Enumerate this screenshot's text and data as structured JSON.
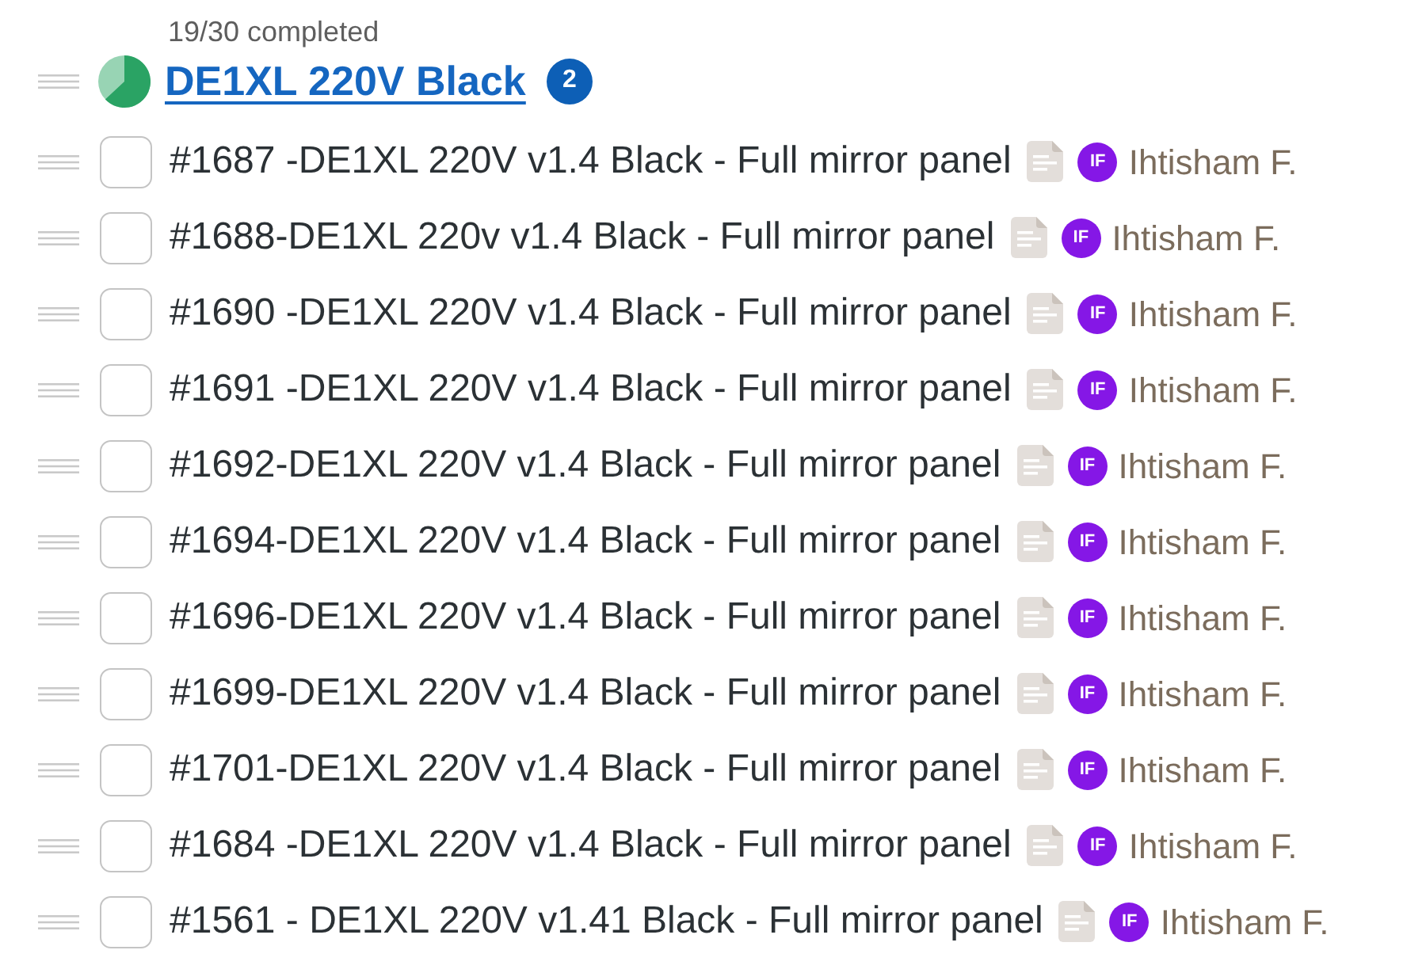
{
  "group": {
    "progress_text": "19/30 completed",
    "title": "DE1XL 220V Black",
    "badge": "2"
  },
  "items": [
    {
      "title": "#1687 -DE1XL 220V v1.4 Black - Full mirror panel",
      "checked": false,
      "has_notes": true,
      "assignee": {
        "initials": "IF",
        "name": "Ihtisham F."
      }
    },
    {
      "title": "#1688-DE1XL 220v v1.4 Black - Full mirror panel",
      "checked": false,
      "has_notes": true,
      "assignee": {
        "initials": "IF",
        "name": "Ihtisham F."
      }
    },
    {
      "title": "#1690 -DE1XL 220V v1.4 Black - Full mirror panel",
      "checked": false,
      "has_notes": true,
      "assignee": {
        "initials": "IF",
        "name": "Ihtisham F."
      }
    },
    {
      "title": "#1691 -DE1XL 220V v1.4 Black - Full mirror panel",
      "checked": false,
      "has_notes": true,
      "assignee": {
        "initials": "IF",
        "name": "Ihtisham F."
      }
    },
    {
      "title": "#1692-DE1XL 220V v1.4 Black - Full mirror panel",
      "checked": false,
      "has_notes": true,
      "assignee": {
        "initials": "IF",
        "name": "Ihtisham F."
      }
    },
    {
      "title": "#1694-DE1XL 220V v1.4 Black - Full mirror panel",
      "checked": false,
      "has_notes": true,
      "assignee": {
        "initials": "IF",
        "name": "Ihtisham F."
      }
    },
    {
      "title": "#1696-DE1XL 220V v1.4 Black - Full mirror panel",
      "checked": false,
      "has_notes": true,
      "assignee": {
        "initials": "IF",
        "name": "Ihtisham F."
      }
    },
    {
      "title": "#1699-DE1XL 220V v1.4 Black - Full mirror panel",
      "checked": false,
      "has_notes": true,
      "assignee": {
        "initials": "IF",
        "name": "Ihtisham F."
      }
    },
    {
      "title": "#1701-DE1XL 220V v1.4 Black - Full mirror panel",
      "checked": false,
      "has_notes": true,
      "assignee": {
        "initials": "IF",
        "name": "Ihtisham F."
      }
    },
    {
      "title": "#1684 -DE1XL 220V v1.4 Black - Full mirror panel",
      "checked": false,
      "has_notes": true,
      "assignee": {
        "initials": "IF",
        "name": "Ihtisham F."
      }
    },
    {
      "title": "#1561 - DE1XL 220V v1.41 Black - Full mirror panel",
      "checked": false,
      "has_notes": true,
      "assignee": {
        "initials": "IF",
        "name": "Ihtisham F."
      }
    }
  ]
}
